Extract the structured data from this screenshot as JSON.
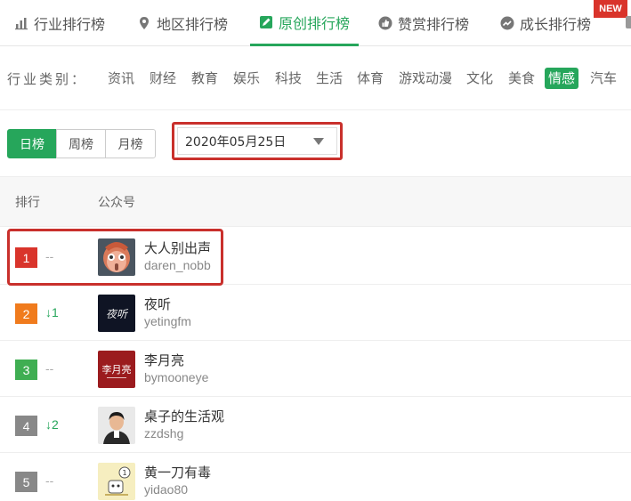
{
  "tabs": [
    {
      "label": "行业排行榜",
      "icon": "bar-chart-icon"
    },
    {
      "label": "地区排行榜",
      "icon": "location-pin-icon"
    },
    {
      "label": "原创排行榜",
      "icon": "edit-icon",
      "active": true
    },
    {
      "label": "赞赏排行榜",
      "icon": "thumbs-up-icon"
    },
    {
      "label": "成长排行榜",
      "icon": "growth-icon"
    }
  ],
  "new_badge": "NEW",
  "categories": {
    "label": "行业类别：",
    "items": [
      "资讯",
      "财经",
      "教育",
      "娱乐",
      "科技",
      "生活",
      "体育",
      "游戏动漫",
      "文化",
      "美食",
      "情感",
      "汽车"
    ],
    "active": "情感"
  },
  "period": {
    "options": [
      "日榜",
      "周榜",
      "月榜"
    ],
    "active": "日榜"
  },
  "date_select": {
    "value": "2020年05月25日"
  },
  "table": {
    "headers": {
      "rank": "排行",
      "account": "公众号"
    },
    "rows": [
      {
        "rank": "1",
        "change": "--",
        "name": "大人别出声",
        "id": "daren_nobb",
        "rank_color": "#d9342b"
      },
      {
        "rank": "2",
        "change": "↓1",
        "name": "夜听",
        "id": "yetingfm",
        "rank_color": "#f07b1d"
      },
      {
        "rank": "3",
        "change": "--",
        "name": "李月亮",
        "id": "bymooneye",
        "rank_color": "#3fae52"
      },
      {
        "rank": "4",
        "change": "↓2",
        "name": "桌子的生活观",
        "id": "zzdshg",
        "rank_color": "#888888"
      },
      {
        "rank": "5",
        "change": "--",
        "name": "黄一刀有毒",
        "id": "yidao80",
        "rank_color": "#888888"
      }
    ]
  },
  "avatar_texts": {
    "row2": "夜听",
    "row3": "李月亮"
  },
  "colors": {
    "accent": "#26a65b",
    "highlight": "#c9302c"
  }
}
